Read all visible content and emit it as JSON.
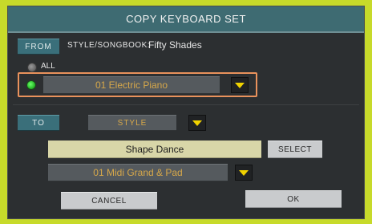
{
  "dialog": {
    "title": "COPY KEYBOARD SET"
  },
  "from": {
    "button_label": "FROM",
    "source_label": "STYLE/SONGBOOK:",
    "source_value": "Fifty Shades",
    "all_label": "ALL",
    "selected_set": "01 Electric Piano"
  },
  "to": {
    "button_label": "TO",
    "type_value": "STYLE",
    "name_value": "Shape Dance",
    "select_label": "SELECT",
    "target_set": "01 Midi Grand & Pad"
  },
  "actions": {
    "cancel_label": "CANCEL",
    "ok_label": "OK"
  },
  "colors": {
    "accent_yellow": "#c7da2a",
    "title_bar": "#3e6b72",
    "highlight": "#e9925c",
    "value_text": "#d7a84a"
  },
  "icons": {
    "dropdown": "triangle-down-icon"
  }
}
